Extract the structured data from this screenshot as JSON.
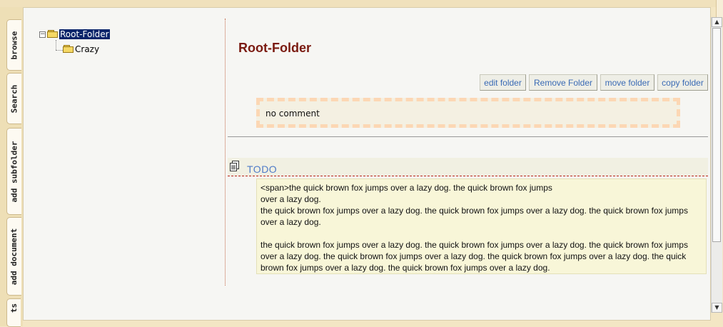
{
  "tabs": [
    "browse",
    "Search",
    "add subfolder",
    "add document",
    "ts"
  ],
  "tree": {
    "root": "Root-Folder",
    "children": [
      "Crazy"
    ]
  },
  "folder": {
    "title": "Root-Folder",
    "comment": "no comment"
  },
  "actions": {
    "edit": "edit folder",
    "remove": "Remove Folder",
    "move": "move folder",
    "copy": "copy folder"
  },
  "todo": {
    "label": "TODO",
    "lines": [
      "<span>the quick brown fox jumps over a lazy dog. the quick brown fox jumps",
      "over a lazy dog.",
      "the quick brown fox jumps over a lazy dog. the quick brown fox jumps over a lazy dog. the quick brown fox jumps over a lazy dog."
    ],
    "paragraph2": "the quick brown fox jumps over a lazy dog. the quick brown fox jumps over a lazy dog. the quick brown fox jumps over a lazy dog. the quick brown fox jumps over a lazy dog. the quick brown fox jumps over a lazy dog. the quick brown fox jumps over a lazy dog. the quick brown fox jumps over a lazy dog."
  },
  "colors": {
    "title": "#7a1a10",
    "link": "#3b6bb5",
    "selection": "#0a246a"
  }
}
